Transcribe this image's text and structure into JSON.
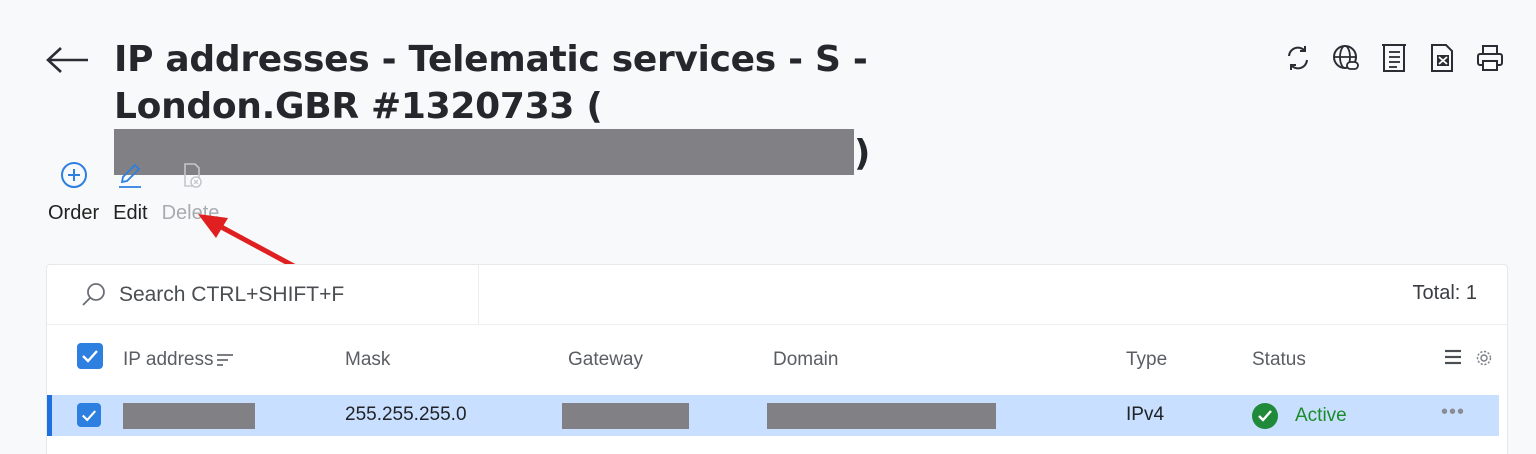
{
  "header": {
    "back_icon": "arrow-left-icon",
    "title": "IP addresses - Telematic services - S - London.GBR #1320733 (",
    "title_close": ")"
  },
  "top_actions": [
    {
      "icon": "refresh-icon"
    },
    {
      "icon": "globe-link-icon"
    },
    {
      "icon": "document-list-icon"
    },
    {
      "icon": "excel-export-icon"
    },
    {
      "icon": "print-icon"
    }
  ],
  "toolbar": {
    "order_label": "Order",
    "edit_label": "Edit",
    "delete_label": "Delete"
  },
  "search": {
    "placeholder": "Search CTRL+SHIFT+F"
  },
  "total": "Total: 1",
  "table": {
    "columns": [
      "IP address",
      "Mask",
      "Gateway",
      "Domain",
      "Type",
      "Status"
    ],
    "rows": [
      {
        "mask": "255.255.255.0",
        "type": "IPv4",
        "status": "Active"
      }
    ]
  },
  "colors": {
    "accent": "#2d7fe0",
    "row_selected": "#c9dfff",
    "status_active": "#1a8c2a",
    "annotation_arrow": "#e02020"
  }
}
